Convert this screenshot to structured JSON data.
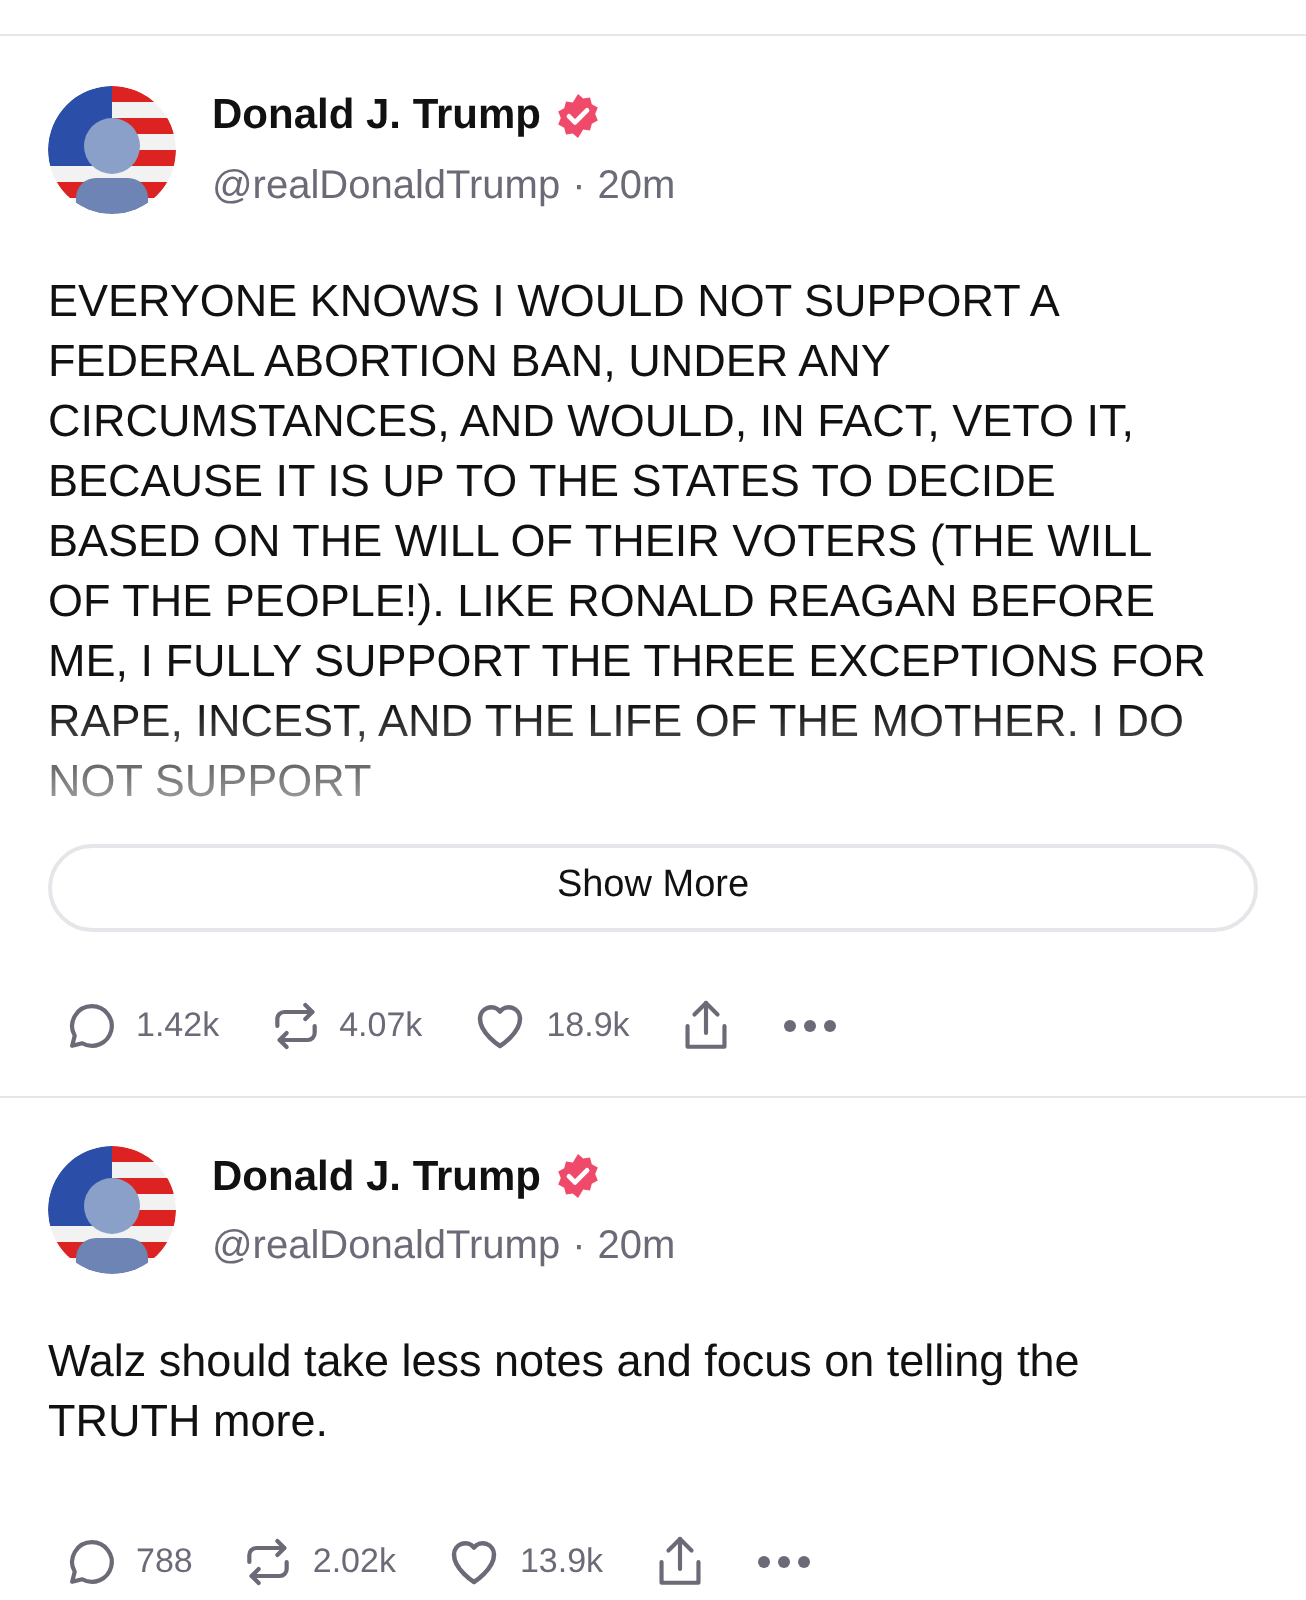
{
  "posts": [
    {
      "name": "Donald J. Trump",
      "verified": true,
      "handle": "@realDonaldTrump",
      "separator": "·",
      "time": "20m",
      "text": "EVERYONE KNOWS I WOULD NOT SUPPORT A FEDERAL ABORTION BAN, UNDER ANY CIRCUMSTANCES, AND WOULD, IN FACT, VETO IT, BECAUSE IT IS UP TO THE STATES TO DECIDE BASED ON THE WILL OF THEIR VOTERS (THE WILL OF THE PEOPLE!). LIKE RONALD REAGAN BEFORE ME, I FULLY SUPPORT THE THREE EXCEPTIONS FOR RAPE, INCEST, AND THE LIFE OF THE MOTHER. I DO NOT SUPPORT",
      "truncated": true,
      "show_more": "Show More",
      "replies": "1.42k",
      "retruths": "4.07k",
      "likes": "18.9k"
    },
    {
      "name": "Donald J. Trump",
      "verified": true,
      "handle": "@realDonaldTrump",
      "separator": "·",
      "time": "20m",
      "text": "Walz should take less notes and focus on telling the TRUTH more.",
      "truncated": false,
      "replies": "788",
      "retruths": "2.02k",
      "likes": "13.9k"
    }
  ]
}
